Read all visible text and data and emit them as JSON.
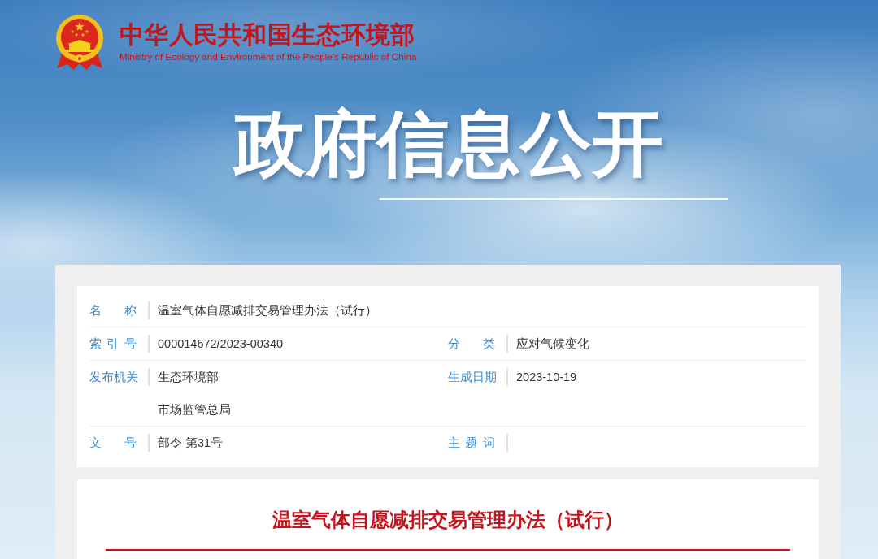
{
  "header": {
    "title": "中华人民共和国生态环境部",
    "subtitle": "Ministry of Ecology and Environment of the People's Republic of China"
  },
  "banner": {
    "title": "政府信息公开"
  },
  "info_table": {
    "rows": [
      {
        "fields": [
          {
            "label": "名 称",
            "values": [
              "温室气体自愿减排交易管理办法（试行）"
            ]
          }
        ]
      },
      {
        "fields": [
          {
            "label": "索 引 号",
            "values": [
              "000014672/2023-00340"
            ]
          },
          {
            "label": "分 类",
            "values": [
              "应对气候变化"
            ]
          }
        ]
      },
      {
        "fields": [
          {
            "label": "发布机关",
            "values": [
              "生态环境部",
              "市场监管总局"
            ]
          },
          {
            "label": "生成日期",
            "values": [
              "2023-10-19"
            ]
          }
        ]
      },
      {
        "fields": [
          {
            "label": "文 号",
            "values": [
              "部令 第31号"
            ]
          },
          {
            "label": "主 题 词"
          }
        ]
      }
    ]
  },
  "document": {
    "title": "温室气体自愿减排交易管理办法（试行）"
  }
}
